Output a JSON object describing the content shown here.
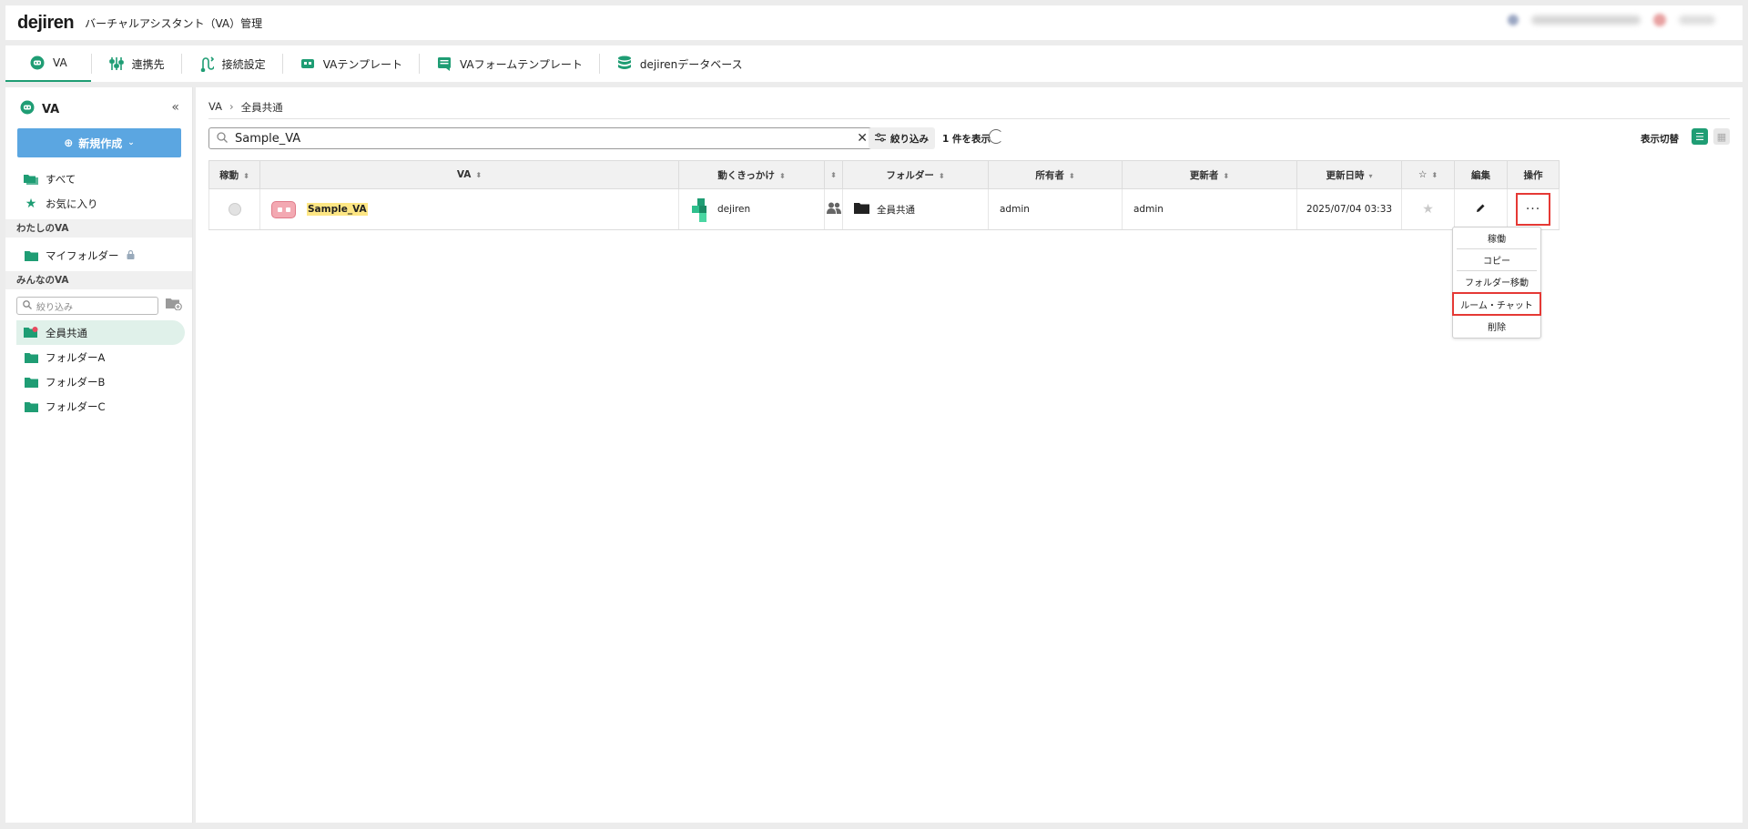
{
  "header": {
    "logo": "dejiren",
    "title": "バーチャルアシスタント（VA）管理"
  },
  "tabs": [
    {
      "label": "VA",
      "icon": "robot-face-icon"
    },
    {
      "label": "連携先",
      "icon": "sliders-icon"
    },
    {
      "label": "接続設定",
      "icon": "connection-icon"
    },
    {
      "label": "VAテンプレート",
      "icon": "robot-template-icon"
    },
    {
      "label": "VAフォームテンプレート",
      "icon": "form-template-icon"
    },
    {
      "label": "dejirenデータベース",
      "icon": "database-icon"
    }
  ],
  "sidebar": {
    "title": "VA",
    "new_button": "新規作成",
    "all": "すべて",
    "favorites": "お気に入り",
    "my_section": "わたしのVA",
    "my_folder": "マイフォルダー",
    "shared_section": "みんなのVA",
    "filter_placeholder": "絞り込み",
    "folders": [
      "全員共通",
      "フォルダーA",
      "フォルダーB",
      "フォルダーC"
    ]
  },
  "main": {
    "breadcrumb": [
      "VA",
      "全員共通"
    ],
    "search_value": "Sample_VA",
    "filter_label": "絞り込み",
    "count_text": "1 件を表示",
    "view_toggle_label": "表示切替"
  },
  "table": {
    "headers": [
      "稼動",
      "VA",
      "動くきっかけ",
      "",
      "フォルダー",
      "所有者",
      "更新者",
      "更新日時",
      "☆",
      "編集",
      "操作"
    ],
    "rows": [
      {
        "name": "Sample_VA",
        "trigger": "dejiren",
        "folder": "全員共通",
        "owner": "admin",
        "updater": "admin",
        "updated": "2025/07/04 03:33"
      }
    ]
  },
  "menu": [
    "稼働",
    "コピー",
    "フォルダー移動",
    "ルーム・チャット",
    "削除"
  ],
  "colors": {
    "accent": "#1f9d74",
    "highlight": "#e53935",
    "primary_button": "#5ba6e1"
  }
}
